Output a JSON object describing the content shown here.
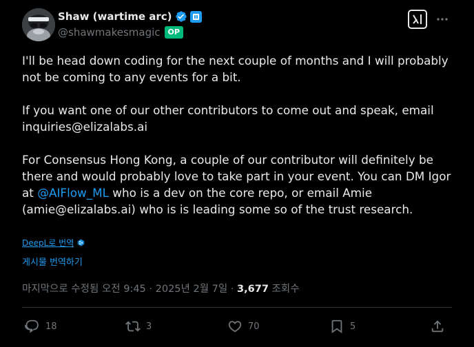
{
  "author": {
    "display_name": "Shaw (wartime arc)",
    "handle": "@shawmakesmagic",
    "op_badge": "OP"
  },
  "icons": {
    "avatar": "avatar-image",
    "verified": "verified-badge-icon",
    "affiliation": "affiliation-badge-icon",
    "grok": "grok-icon",
    "more": "more-options-icon",
    "deepl": "deepl-icon",
    "reply": "reply-icon",
    "repost": "repost-icon",
    "like": "heart-icon",
    "bookmark": "bookmark-icon",
    "share": "share-icon"
  },
  "tweet": {
    "paragraph_1": "I'll be head down coding for the next couple of months and I will probably not be coming to any events for a bit.",
    "paragraph_2": "If you want one of our other contributors to come out and speak, email inquiries@elizalabs.ai",
    "paragraph_3_part_1": "For Consensus Hong Kong, a couple of our contributor will definitely be there and would probably love to take part in your event. You can DM Igor at ",
    "paragraph_3_mention": "@AIFlow_ML",
    "paragraph_3_part_2": " who is a dev on the core repo, or email Amie (amie@elizalabs.ai) who is is leading some so of the trust research."
  },
  "translation": {
    "deepl_label": "DeepL로 번역",
    "translate_post_label": "게시물 번역하기"
  },
  "meta": {
    "edited_time": "마지막으로 수정됨 오전 9:45 · 2025년 2월 7일 · ",
    "views_count": "3,677",
    "views_label": " 조회수"
  },
  "actions": {
    "reply_count": "18",
    "repost_count": "3",
    "like_count": "70",
    "bookmark_count": "5"
  },
  "colors": {
    "background": "#000000",
    "text_primary": "#e7e9ea",
    "text_secondary": "#71767b",
    "link": "#1d9bf0",
    "op_badge": "#00ba7c",
    "divider": "#2f3336"
  }
}
